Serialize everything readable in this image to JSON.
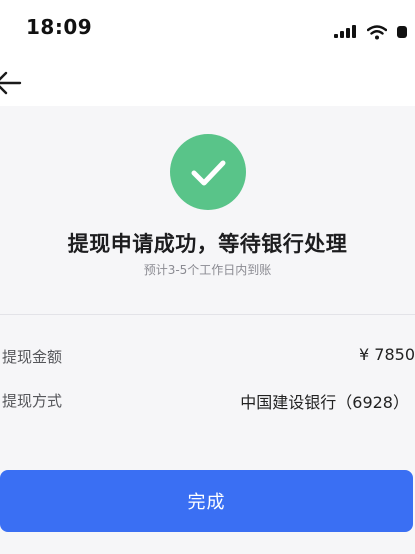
{
  "status_bar": {
    "time": "18:09"
  },
  "icons": {
    "back": "back-arrow-icon",
    "success": "checkmark-icon",
    "signal": "signal-icon",
    "wifi": "wifi-icon",
    "battery": "battery-icon"
  },
  "colors": {
    "success_green": "#59c489",
    "primary_blue": "#3a6ff3",
    "page_background": "#f6f6f8"
  },
  "result": {
    "title": "提现申请成功，等待银行处理",
    "subtitle": "预计3-5个工作日内到账"
  },
  "details": [
    {
      "label": "提现金额",
      "value": "¥ 7850"
    },
    {
      "label": "提现方式",
      "value": "中国建设银行（6928）"
    }
  ],
  "actions": {
    "done_label": "完成"
  }
}
